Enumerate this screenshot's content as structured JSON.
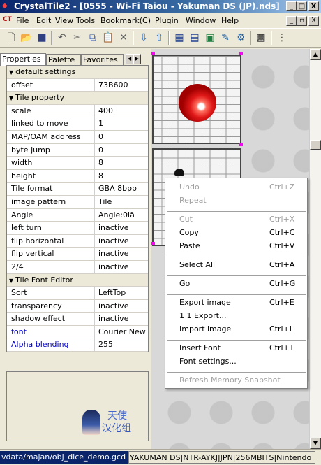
{
  "window": {
    "title": "CrystalTile2 - [0555 - Wi-Fi Taiou - Yakuman DS (JP).nds]",
    "controls": [
      "_",
      "□",
      "X"
    ],
    "mdi_controls": [
      "_",
      "▫",
      "X"
    ]
  },
  "menubar": {
    "logo": "CT",
    "items": [
      "File",
      "Edit",
      "View",
      "Tools",
      "Bookmark(C)",
      "Plugin",
      "Window",
      "Help"
    ]
  },
  "toolbar": {
    "buttons": [
      "new-icon",
      "open-icon",
      "save-icon",
      "undo-icon",
      "cut-icon",
      "copy-icon",
      "paste-icon",
      "delete-icon",
      "import-icon",
      "export-icon",
      "tile-view-icon",
      "hex-view-icon",
      "font-icon",
      "edit-icon",
      "settings-icon",
      "grid-icon",
      "more-icon"
    ]
  },
  "tabs": [
    "Properties",
    "Palette",
    "Favorites"
  ],
  "properties": {
    "default_settings": {
      "label": "default settings",
      "rows": [
        {
          "name": "offset",
          "value": "73B600"
        }
      ]
    },
    "tile_property": {
      "label": "Tile property",
      "rows": [
        {
          "name": "scale",
          "value": "400"
        },
        {
          "name": "linked to move",
          "value": "1"
        },
        {
          "name": "MAP/OAM address",
          "value": "0"
        },
        {
          "name": "byte jump",
          "value": "0"
        },
        {
          "name": "width",
          "value": "8"
        },
        {
          "name": "height",
          "value": "8"
        },
        {
          "name": "Tile format",
          "value": "GBA 8bpp"
        },
        {
          "name": "image pattern",
          "value": "Tile"
        },
        {
          "name": "Angle",
          "value": "Angle:0iã"
        },
        {
          "name": "left turn",
          "value": "inactive"
        },
        {
          "name": "flip horizontal",
          "value": "inactive"
        },
        {
          "name": "flip vertical",
          "value": "inactive"
        },
        {
          "name": "2/4",
          "value": "inactive"
        }
      ]
    },
    "tile_font_editor": {
      "label": "Tile Font Editor",
      "rows": [
        {
          "name": "Sort",
          "value": "LeftTop"
        },
        {
          "name": "transparency",
          "value": "inactive"
        },
        {
          "name": "shadow effect",
          "value": "inactive"
        },
        {
          "name": "font",
          "value": "Courier New"
        },
        {
          "name": "Alpha blending",
          "value": "255"
        }
      ]
    }
  },
  "logo": {
    "line1": "天使",
    "line2": "汉化组"
  },
  "context_menu": {
    "items": [
      {
        "label": "Undo",
        "shortcut": "Ctrl+Z",
        "disabled": true
      },
      {
        "label": "Repeat",
        "shortcut": "",
        "disabled": true
      },
      {
        "label": "Cut",
        "shortcut": "Ctrl+X",
        "disabled": true
      },
      {
        "label": "Copy",
        "shortcut": "Ctrl+C",
        "disabled": false
      },
      {
        "label": "Paste",
        "shortcut": "Ctrl+V",
        "disabled": false
      },
      {
        "label": "Select All",
        "shortcut": "Ctrl+A",
        "disabled": false
      },
      {
        "label": "Go",
        "shortcut": "Ctrl+G",
        "disabled": false
      },
      {
        "label": "Export image",
        "shortcut": "Ctrl+E",
        "disabled": false
      },
      {
        "label": "1 1 Export...",
        "shortcut": "",
        "disabled": false
      },
      {
        "label": "Import image",
        "shortcut": "Ctrl+I",
        "disabled": false
      },
      {
        "label": "Insert Font",
        "shortcut": "Ctrl+T",
        "disabled": false
      },
      {
        "label": "Font settings...",
        "shortcut": "",
        "disabled": false
      },
      {
        "label": "Refresh Memory Snapshot",
        "shortcut": "",
        "disabled": true
      }
    ]
  },
  "statusbar": {
    "path": "vdata/majan/obj_dice_demo.gcd",
    "info": "YAKUMAN DS|NTR-AYKJ|JPN|256MBITS|Nintendo"
  },
  "colors": {
    "title_bar": "#0a246a",
    "highlight": "#0a246a",
    "blue_text": "#0000cc",
    "selection_handle": "#ff00ff",
    "dice_pip": "#e01818"
  }
}
